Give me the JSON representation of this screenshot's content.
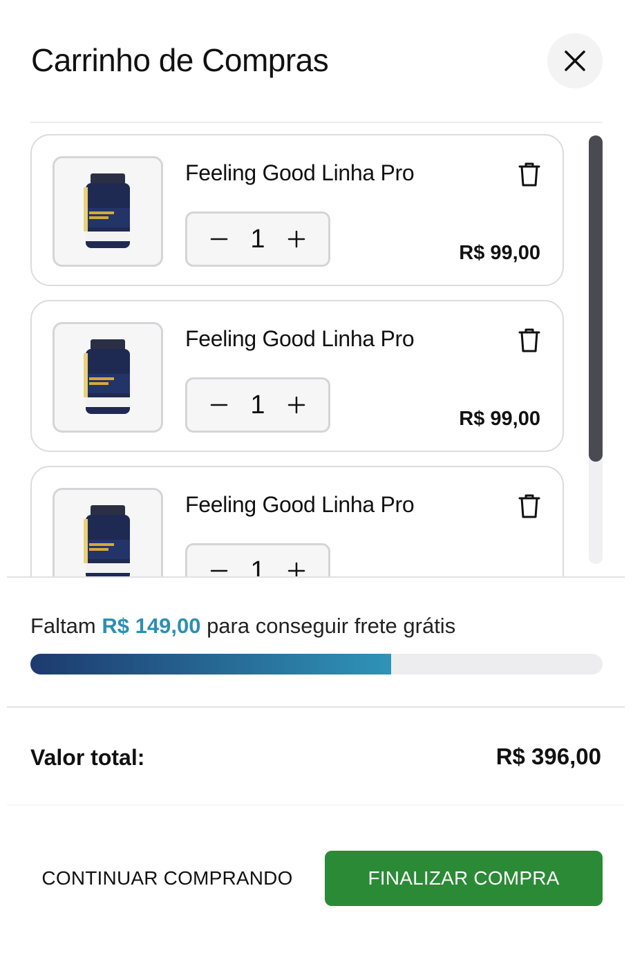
{
  "cart": {
    "title": "Carrinho de Compras",
    "close_icon": "close-icon",
    "items": [
      {
        "name": "Feeling Good Linha Pro",
        "quantity": "1",
        "price": "R$ 99,00",
        "decrease": "−",
        "increase": "+"
      },
      {
        "name": "Feeling Good Linha Pro",
        "quantity": "1",
        "price": "R$ 99,00",
        "decrease": "−",
        "increase": "+"
      },
      {
        "name": "Feeling Good Linha Pro",
        "quantity": "1",
        "price": "",
        "decrease": "−",
        "increase": "+"
      }
    ]
  },
  "shipping": {
    "prefix": "Faltam",
    "amount": "R$ 149,00",
    "suffix": "para conseguir frete grátis",
    "progress_percent": 63
  },
  "summary": {
    "total_label": "Valor total:",
    "total_value": "R$ 396,00"
  },
  "footer": {
    "continue_label": "CONTINUAR COMPRANDO",
    "finalize_label": "FINALIZAR COMPRA"
  },
  "colors": {
    "accent": "#2b8fb3",
    "progress_start": "#1d3a6e",
    "progress_end": "#2f93b8",
    "finalize": "#2b8a35"
  }
}
